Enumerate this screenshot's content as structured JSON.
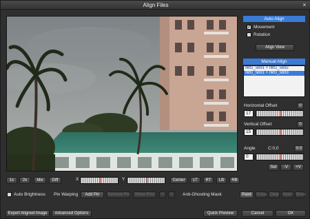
{
  "window": {
    "title": "Align Files",
    "close_label": "×"
  },
  "auto_align": {
    "header": "Auto Align",
    "movement_label": "Movement",
    "movement_checked": true,
    "rotation_label": "Rotation",
    "rotation_checked": false,
    "align_view_label": "Align View"
  },
  "manual_align": {
    "header": "Manual Align",
    "items": [
      {
        "label": "IMG_5691 + IMG_5692",
        "selected": false
      },
      {
        "label": "IMG_5691 + IMG_5693",
        "selected": true
      }
    ]
  },
  "horizontal_offset": {
    "label": "Horizontal Offset",
    "value": "17",
    "reset_label": "0"
  },
  "vertical_offset": {
    "label": "Vertical Offset",
    "value": "15",
    "reset_label": "0"
  },
  "angle": {
    "label": "Angle",
    "readout": "C:0,0",
    "reset_label": "0.0",
    "value": "0",
    "set_label": "Set",
    "v_label": "-V",
    "plus_v_label": "+V"
  },
  "zoom": {
    "buttons": [
      "1x",
      "2x",
      "Mix",
      "Diff"
    ]
  },
  "xy": {
    "x_label": "X",
    "y_label": "Y"
  },
  "position_buttons": [
    "Center",
    "LT",
    "RT",
    "LB",
    "RB"
  ],
  "auto_brightness": {
    "label": "Auto Brightness",
    "checked": false
  },
  "pin_warping": {
    "label": "Pin Warping",
    "add_pin_label": "Add Pin",
    "remove_label": "Remove Pin",
    "show_label": "Show Pins",
    "prev_label": "<",
    "next_label": ">"
  },
  "anti_ghosting": {
    "label": "Anti-Ghosting Mask",
    "paint_label": "Paint",
    "erase_label": "Erase",
    "clear_label": "Clear",
    "invert_label": "Invert",
    "show_label": "Show"
  },
  "footer": {
    "export_label": "Export Aligned Image",
    "advanced_label": "Advanced Options",
    "quick_preview_label": "Quick Preview",
    "cancel_label": "Cancel",
    "ok_label": "OK"
  }
}
